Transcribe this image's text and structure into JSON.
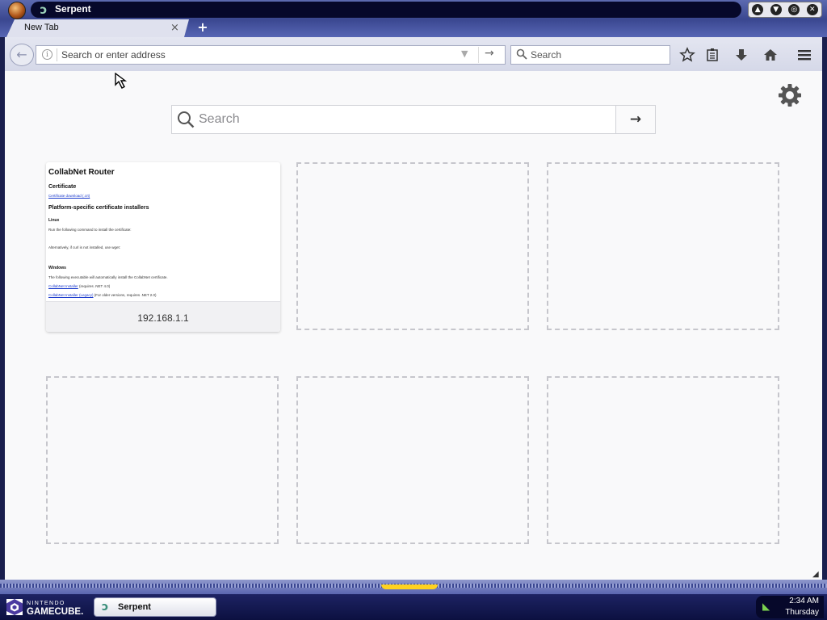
{
  "window": {
    "title": "Serpent",
    "controls": [
      "up",
      "down",
      "maximize",
      "close"
    ]
  },
  "tabs": [
    {
      "label": "New Tab",
      "close_glyph": "×"
    }
  ],
  "tabstrip": {
    "new_tab_glyph": "+"
  },
  "toolbar": {
    "back_glyph": "←",
    "url_placeholder": "Search or enter address",
    "url_value": "",
    "go_glyph": "→",
    "search_placeholder": "Search",
    "icons": [
      "bookmark-star-icon",
      "reading-list-icon",
      "downloads-icon",
      "home-icon",
      "menu-icon"
    ]
  },
  "newtab": {
    "search_placeholder": "Search",
    "search_go_glyph": "→",
    "tiles": [
      {
        "title": "192.168.1.1",
        "thumbnail": {
          "heading": "CollabNet Router",
          "sections": [
            {
              "heading": "Certificate",
              "links": [
                "Certificate download (.crt)"
              ]
            },
            {
              "heading": "Platform-specific certificate installers"
            }
          ],
          "linux_heading": "Linux",
          "linux_text_1": "Run the following command to install the certificate:",
          "linux_text_2": "Alternatively, if curl is not installed, use wget:",
          "windows_heading": "Windows",
          "windows_text": "The following executable will automatically install the CollabNet certificate.",
          "windows_link_1": "CollabNet Installer",
          "windows_link_1_note": "(requires .NET 4.0)",
          "windows_link_2": "CollabNet Installer (Legacy)",
          "windows_link_2_note": "(For older versions, requires .NET 2.0)"
        }
      },
      {
        "empty": true
      },
      {
        "empty": true
      },
      {
        "empty": true
      },
      {
        "empty": true
      },
      {
        "empty": true
      }
    ]
  },
  "taskbar": {
    "start_label_top": "NINTENDO",
    "start_label_bottom": "GAMECUBE.",
    "task_label": "Serpent",
    "clock_time": "2:34 AM",
    "clock_day": "Thursday"
  },
  "colors": {
    "frame": "#5766b4",
    "taskbar": "#0c1040",
    "titlebar_pill": "#06082a",
    "content_bg": "#f9f9fa",
    "accent_yellow": "#ffd21f"
  }
}
